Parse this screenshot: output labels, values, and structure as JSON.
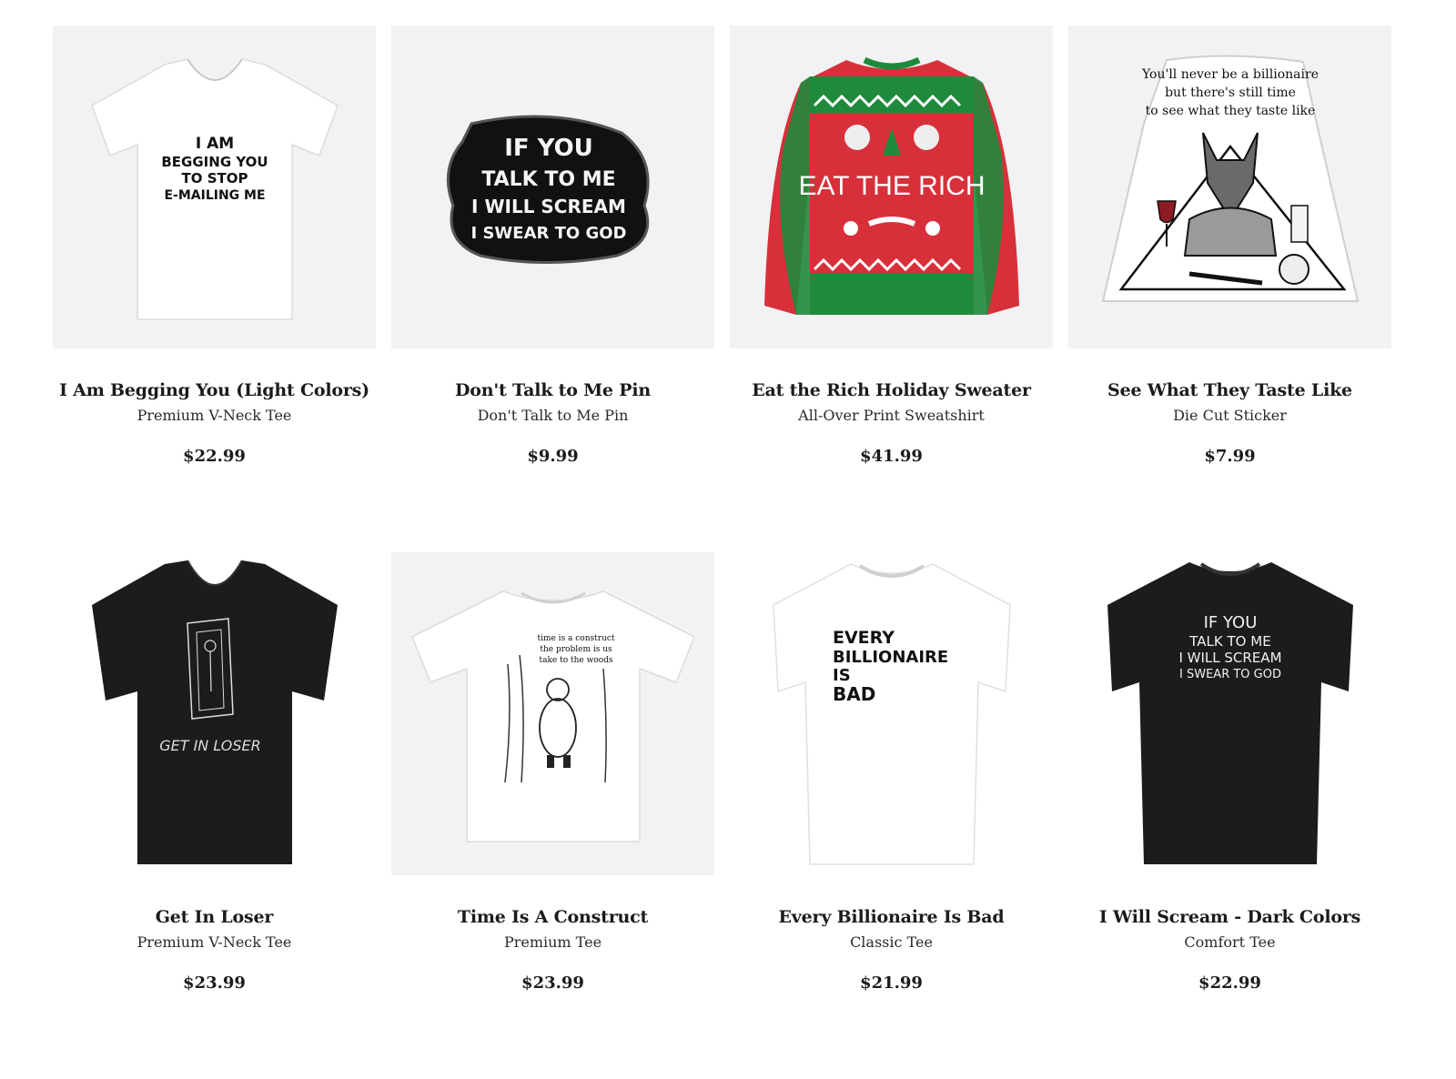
{
  "products": [
    {
      "title": "I Am Begging You (Light Colors)",
      "type": "Premium V-Neck Tee",
      "price": "$22.99",
      "art_lines": [
        "I AM",
        "BEGGING YOU",
        "TO STOP",
        "E-MAILING ME"
      ],
      "icon": "white-vneck-tee"
    },
    {
      "title": "Don't Talk to Me Pin",
      "type": "Don't Talk to Me Pin",
      "price": "$9.99",
      "art_lines": [
        "IF YOU",
        "TALK TO ME",
        "I WILL SCREAM",
        "I SWEAR TO GOD"
      ],
      "icon": "enamel-pin"
    },
    {
      "title": "Eat the Rich Holiday Sweater",
      "type": "All-Over Print Sweatshirt",
      "price": "$41.99",
      "art_lines": [
        "EAT THE RICH"
      ],
      "icon": "holiday-sweater"
    },
    {
      "title": "See What They Taste Like",
      "type": "Die Cut Sticker",
      "price": "$7.99",
      "art_lines": [
        "You'll never be a billionaire",
        "but there's still time",
        "to see what they taste like"
      ],
      "icon": "wolf-sticker"
    },
    {
      "title": "Get In Loser",
      "type": "Premium V-Neck Tee",
      "price": "$23.99",
      "art_lines": [
        "GET IN LOSER"
      ],
      "icon": "black-vneck-tee"
    },
    {
      "title": "Time Is A Construct",
      "type": "Premium Tee",
      "price": "$23.99",
      "art_lines": [
        "time is a construct",
        "the problem is us",
        "take to the woods"
      ],
      "icon": "white-tee"
    },
    {
      "title": "Every Billionaire Is Bad",
      "type": "Classic Tee",
      "price": "$21.99",
      "art_lines": [
        "EVERY",
        "BILLIONAIRE",
        "IS",
        "BAD"
      ],
      "icon": "white-tee"
    },
    {
      "title": "I Will Scream - Dark Colors",
      "type": "Comfort Tee",
      "price": "$22.99",
      "art_lines": [
        "IF YOU",
        "TALK TO ME",
        "I WILL SCREAM",
        "I SWEAR TO GOD"
      ],
      "icon": "black-tee"
    }
  ],
  "colors": {
    "thumb_bg": "#f2f2f4",
    "sweater_red": "#d8303a",
    "sweater_green": "#1f8a3c",
    "black_tee": "#1c1c1c"
  }
}
